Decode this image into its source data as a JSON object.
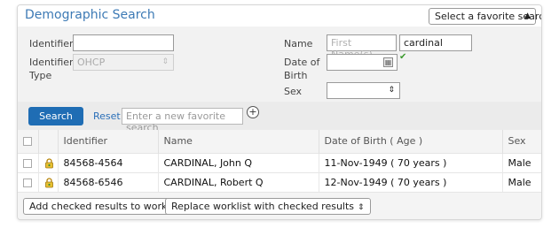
{
  "header": {
    "title": "Demographic Search",
    "favorite_select": "Select a favorite search"
  },
  "form": {
    "identifier_label": "Identifier",
    "identifier_value": "",
    "identifier_type_label_1": "Identifier",
    "identifier_type_label_2": "Type",
    "identifier_type_value": "OHCP",
    "name_label": "Name",
    "first_name_placeholder": "First Name(s)",
    "last_name_value": "cardinal",
    "dob_label_1": "Date of",
    "dob_label_2": "Birth",
    "dob_value": "",
    "sex_label": "Sex",
    "sex_value": ""
  },
  "actions": {
    "search_label": "Search",
    "reset_label": "Reset",
    "favorite_name_placeholder": "Enter a new favorite search"
  },
  "table": {
    "columns": [
      "",
      "",
      "Identifier",
      "Name",
      "Date of Birth ( Age )",
      "Sex"
    ],
    "rows": [
      {
        "identifier": "84568-4564",
        "name": "CARDINAL, John Q",
        "dob": "11-Nov-1949 ( 70 years )",
        "sex": "Male"
      },
      {
        "identifier": "84568-6546",
        "name": "CARDINAL, Robert Q",
        "dob": "12-Nov-1949 ( 70 years )",
        "sex": "Male"
      }
    ]
  },
  "footer": {
    "add_label": "Add checked results to worklist",
    "replace_label": "Replace worklist with checked results"
  },
  "colors": {
    "title": "#3d7ab5",
    "search_button": "#1f6db4",
    "reset_link": "#2a6fb8",
    "valid_check": "#3c9a2e"
  }
}
